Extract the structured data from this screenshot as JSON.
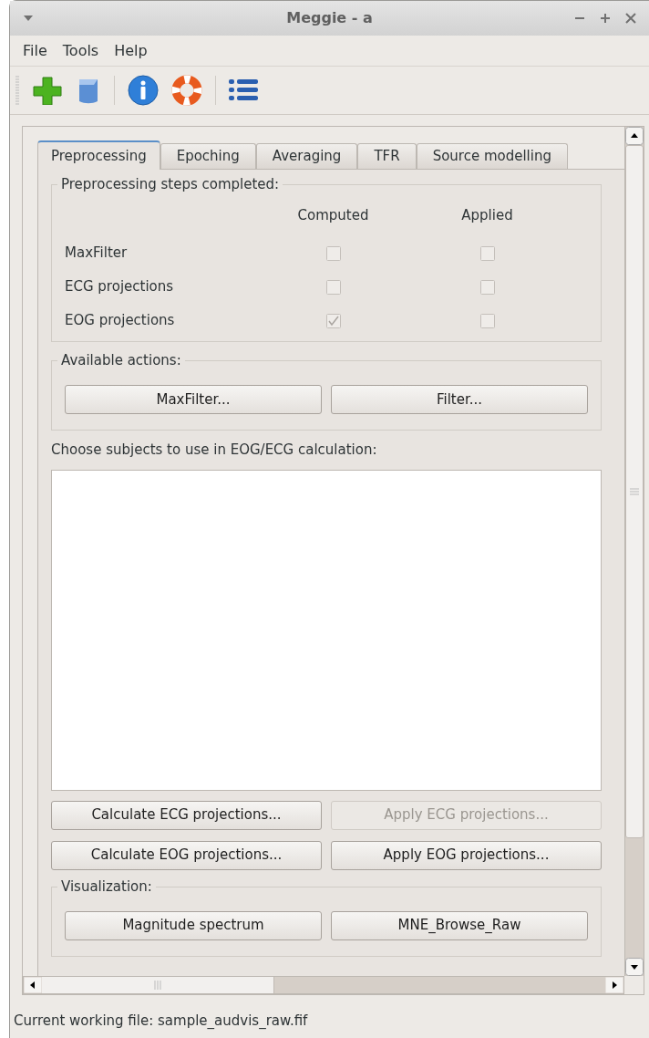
{
  "window": {
    "title": "Meggie - a"
  },
  "menu": [
    "File",
    "Tools",
    "Help"
  ],
  "tabs": [
    {
      "label": "Preprocessing",
      "selected": true
    },
    {
      "label": "Epoching",
      "selected": false
    },
    {
      "label": "Averaging",
      "selected": false
    },
    {
      "label": "TFR",
      "selected": false
    },
    {
      "label": "Source modelling",
      "selected": false
    }
  ],
  "steps_group": {
    "title": "Preprocessing steps completed:",
    "columns": [
      "Computed",
      "Applied"
    ],
    "rows": [
      {
        "label": "MaxFilter",
        "computed": false,
        "applied": false
      },
      {
        "label": "ECG projections",
        "computed": false,
        "applied": false
      },
      {
        "label": "EOG projections",
        "computed": true,
        "applied": false
      }
    ]
  },
  "actions_group": {
    "title": "Available actions:",
    "buttons": [
      {
        "label": "MaxFilter...",
        "disabled": false
      },
      {
        "label": "Filter...",
        "disabled": false
      }
    ]
  },
  "subjects": {
    "label": "Choose subjects to use in EOG/ECG calculation:"
  },
  "projection_buttons": [
    {
      "label": "Calculate ECG projections...",
      "disabled": false
    },
    {
      "label": "Apply ECG projections...",
      "disabled": true
    },
    {
      "label": "Calculate EOG projections...",
      "disabled": false
    },
    {
      "label": "Apply EOG projections...",
      "disabled": false
    }
  ],
  "visualization_group": {
    "title": "Visualization:",
    "buttons": [
      {
        "label": "Magnitude spectrum",
        "disabled": false
      },
      {
        "label": "MNE_Browse_Raw",
        "disabled": false
      }
    ]
  },
  "status_bar": "Current working file: sample_audvis_raw.fif"
}
